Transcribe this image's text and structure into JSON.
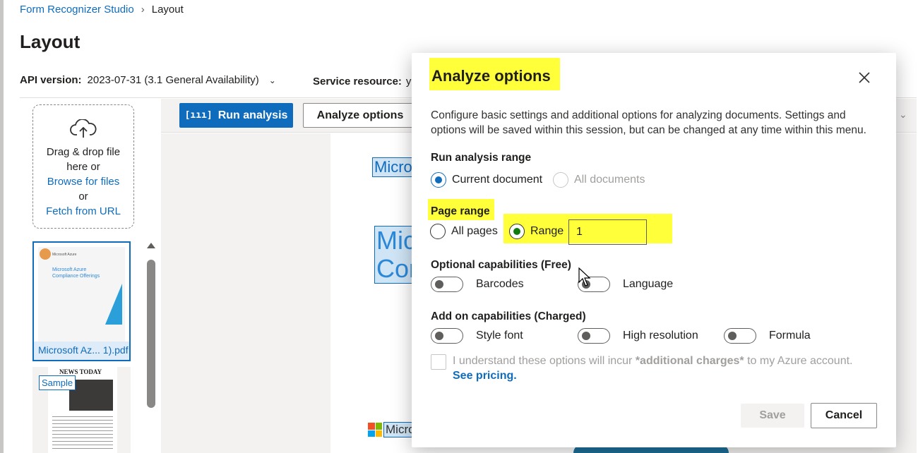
{
  "breadcrumb": {
    "root": "Form Recognizer Studio",
    "separator": "›",
    "current": "Layout"
  },
  "page_title": "Layout",
  "api": {
    "label": "API version:",
    "value": "2023-07-31 (3.1 General Availability)"
  },
  "service": {
    "label": "Service resource:",
    "value": "y"
  },
  "dropzone": {
    "line1": "Drag & drop file",
    "line2": "here or",
    "browse": "Browse for files",
    "or": "or",
    "fetch": "Fetch from URL"
  },
  "files": [
    {
      "name": "Microsoft Az... 1).pdf",
      "thumb_title": "Microsoft Azure Compliance Offerings",
      "thumb_brand": "Microsoft Azure"
    },
    {
      "badge": "Sample",
      "thumb_title": "NEWS TODAY"
    }
  ],
  "toolbar": {
    "run_label": "Run analysis",
    "options_label": "Analyze options"
  },
  "document": {
    "text1": "Micro",
    "text2": "Mic Con",
    "text3": "Micro"
  },
  "dialog": {
    "title": "Analyze options",
    "description": "Configure basic settings and additional options for analyzing documents. Settings and options will be saved within this session, but can be changed at any time within this menu.",
    "run_range": {
      "label": "Run analysis range",
      "options": [
        {
          "label": "Current document",
          "selected": true,
          "disabled": false
        },
        {
          "label": "All documents",
          "selected": false,
          "disabled": true
        }
      ]
    },
    "page_range": {
      "label": "Page range",
      "options": [
        {
          "label": "All pages",
          "selected": false
        },
        {
          "label": "Range",
          "selected": true
        }
      ],
      "range_value": "1"
    },
    "optional": {
      "label": "Optional capabilities (Free)",
      "toggles": [
        {
          "label": "Barcodes",
          "on": false
        },
        {
          "label": "Language",
          "on": false
        }
      ]
    },
    "addon": {
      "label": "Add on capabilities (Charged)",
      "toggles": [
        {
          "label": "Style font",
          "on": false
        },
        {
          "label": "High resolution",
          "on": false
        },
        {
          "label": "Formula",
          "on": false
        }
      ]
    },
    "consent": {
      "prefix": "I understand these options will incur ",
      "bold": "*additional charges*",
      "suffix": " to my Azure account.",
      "link": "See pricing."
    },
    "save_label": "Save",
    "cancel_label": "Cancel"
  },
  "colors": {
    "accent": "#0f6cbd",
    "highlight": "#ffff3a",
    "range_selected": "#107c10"
  },
  "icons": [
    "chevron-down-icon",
    "cloud-upload-icon",
    "scan-icon",
    "chevron-right-icon",
    "close-icon",
    "microsoft-logo-icon",
    "mouse-cursor-icon"
  ]
}
